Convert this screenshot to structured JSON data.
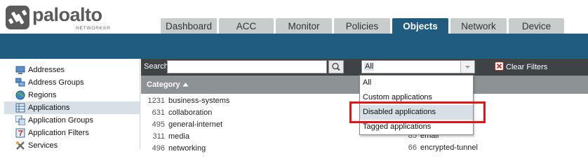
{
  "brand": {
    "name": "paloalto",
    "sub": "NETWORKS®"
  },
  "tabs": [
    {
      "label": "Dashboard",
      "active": false
    },
    {
      "label": "ACC",
      "active": false
    },
    {
      "label": "Monitor",
      "active": false
    },
    {
      "label": "Policies",
      "active": false
    },
    {
      "label": "Objects",
      "active": true
    },
    {
      "label": "Network",
      "active": false
    },
    {
      "label": "Device",
      "active": false
    }
  ],
  "sidebar": {
    "items": [
      {
        "label": "Addresses",
        "icon": "addresses-icon",
        "selected": false
      },
      {
        "label": "Address Groups",
        "icon": "address-groups-icon",
        "selected": false
      },
      {
        "label": "Regions",
        "icon": "globe-icon",
        "selected": false
      },
      {
        "label": "Applications",
        "icon": "applications-icon",
        "selected": true
      },
      {
        "label": "Application Groups",
        "icon": "application-groups-icon",
        "selected": false
      },
      {
        "label": "Application Filters",
        "icon": "filter-icon",
        "selected": false
      },
      {
        "label": "Services",
        "icon": "services-icon",
        "selected": false
      }
    ]
  },
  "filterbar": {
    "search_label": "Search",
    "search_value": "",
    "select_value": "All",
    "clear_filters": "Clear Filters"
  },
  "category_header": {
    "label": "Category"
  },
  "categories": [
    {
      "count": "1231",
      "name": "business-systems"
    },
    {
      "count": "631",
      "name": "collaboration"
    },
    {
      "count": "495",
      "name": "general-internet"
    },
    {
      "count": "311",
      "name": "media"
    },
    {
      "count": "496",
      "name": "networking"
    }
  ],
  "subcategories": [
    {
      "count": "85",
      "name": "email"
    },
    {
      "count": "66",
      "name": "encrypted-tunnel"
    }
  ],
  "dropdown": {
    "options": [
      "All",
      "Custom applications",
      "Disabled applications",
      "Tagged applications"
    ],
    "hovered": "Disabled applications"
  },
  "colors": {
    "accent": "#1f5c80",
    "highlight": "#e3151b"
  }
}
